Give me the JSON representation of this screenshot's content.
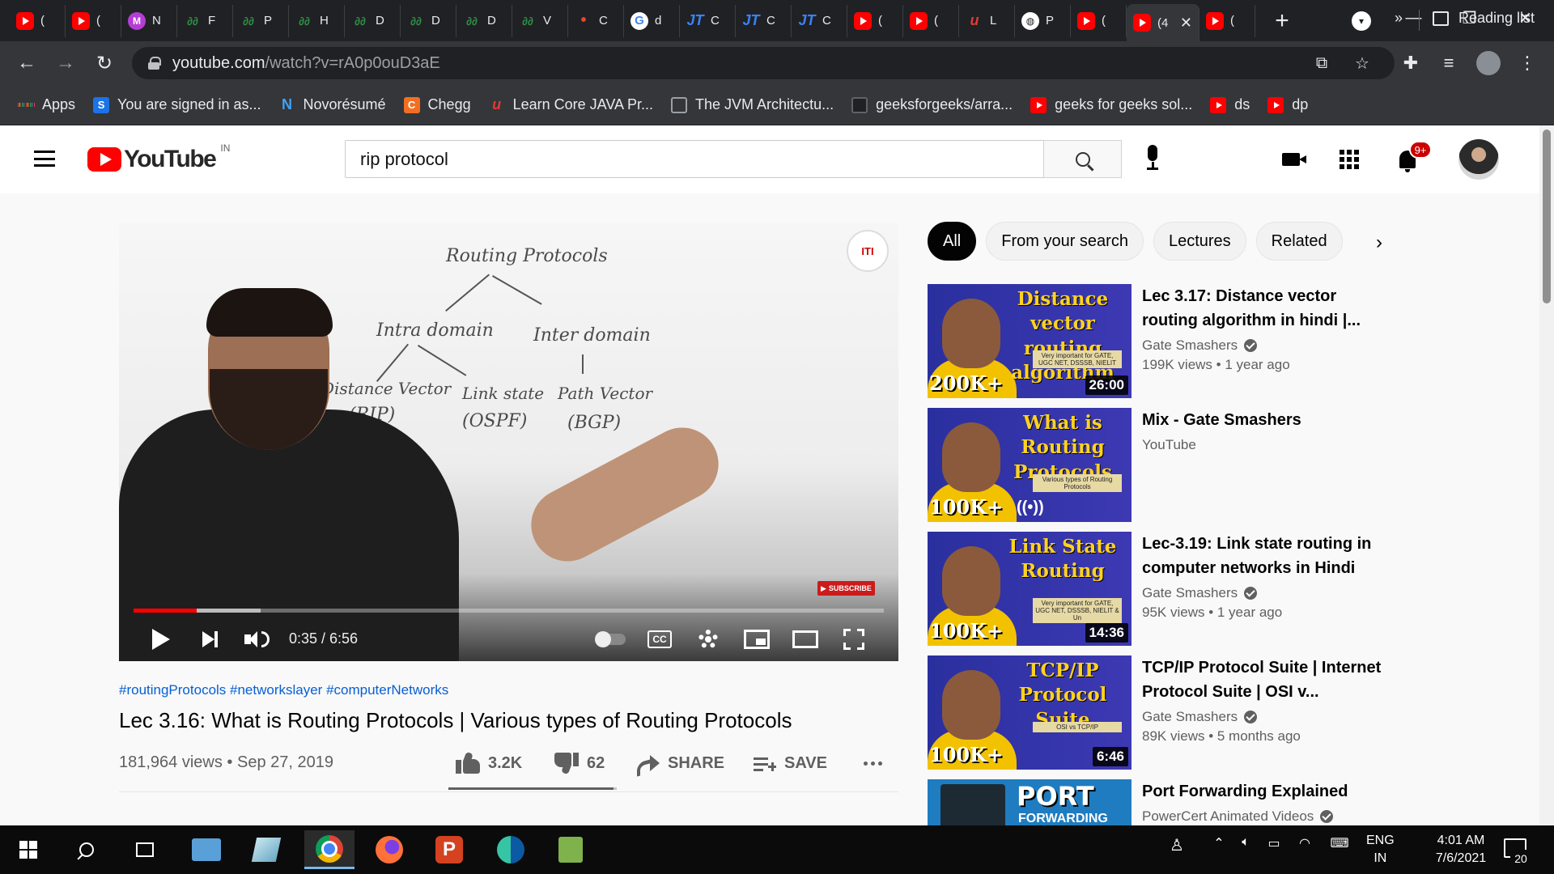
{
  "browser": {
    "tabs": [
      {
        "favicon": "youtube-icon",
        "label": "("
      },
      {
        "favicon": "youtube-icon",
        "label": "("
      },
      {
        "favicon": "messenger-m-icon",
        "label": "N"
      },
      {
        "favicon": "gfg-icon",
        "label": "F"
      },
      {
        "favicon": "gfg-icon",
        "label": "P"
      },
      {
        "favicon": "gfg-icon",
        "label": "H"
      },
      {
        "favicon": "gfg-icon",
        "label": "D"
      },
      {
        "favicon": "gfg-icon",
        "label": "D"
      },
      {
        "favicon": "gfg-icon",
        "label": "D"
      },
      {
        "favicon": "gfg-icon",
        "label": "V"
      },
      {
        "favicon": "red-dot-icon",
        "label": "C"
      },
      {
        "favicon": "google-icon",
        "label": "d"
      },
      {
        "favicon": "javatpoint-icon",
        "label": "C"
      },
      {
        "favicon": "javatpoint-icon",
        "label": "C"
      },
      {
        "favicon": "javatpoint-icon",
        "label": "C"
      },
      {
        "favicon": "youtube-icon",
        "label": "("
      },
      {
        "favicon": "youtube-icon",
        "label": "("
      },
      {
        "favicon": "udemy-icon",
        "label": "L"
      },
      {
        "favicon": "globe-icon",
        "label": "P"
      },
      {
        "favicon": "youtube-icon",
        "label": "("
      },
      {
        "favicon": "youtube-icon",
        "label": "(4",
        "active": true
      },
      {
        "favicon": "youtube-icon",
        "label": "("
      }
    ],
    "new_tab": "+",
    "url_host": "youtube.com",
    "url_path": "/watch?v=rA0p0ouD3aE",
    "bookmarks": [
      {
        "icon": "apps-grid-icon",
        "label": "Apps"
      },
      {
        "icon": "s-icon",
        "label": "You are signed in as..."
      },
      {
        "icon": "novoresume-icon",
        "label": "Novorésumé"
      },
      {
        "icon": "chegg-icon",
        "label": "Chegg"
      },
      {
        "icon": "udemy-icon",
        "label": "Learn Core JAVA Pr..."
      },
      {
        "icon": "jvm-icon",
        "label": "The JVM Architectu..."
      },
      {
        "icon": "github-icon",
        "label": "geeksforgeeks/arra..."
      },
      {
        "icon": "youtube-icon",
        "label": "geeks for geeks sol..."
      },
      {
        "icon": "youtube-icon",
        "label": "ds"
      },
      {
        "icon": "youtube-icon",
        "label": "dp"
      }
    ],
    "bookmarks_more": "»",
    "reading_list": "Reading list"
  },
  "youtube": {
    "logo_text": "YouTube",
    "country_code": "IN",
    "search_query": "rip protocol",
    "notification_count": "9+",
    "accent_color": "#ff0000"
  },
  "player": {
    "time_display": "0:35 / 6:56",
    "progress_played_fraction": 0.084,
    "progress_buffered_fraction": 0.169,
    "subscribe_watermark": "SUBSCRIBE",
    "cc_label": "CC",
    "whiteboard": {
      "root": "Routing Protocols",
      "left": "Intra domain",
      "right": "Inter domain",
      "leaf1": "Distance Vector",
      "leaf1_sub": "(RIP)",
      "leaf2": "Link state",
      "leaf2_sub": "(OSPF)",
      "leaf3": "Path Vector",
      "leaf3_sub": "(BGP)"
    }
  },
  "video": {
    "hashtags": "#routingProtocols #networkslayer #computerNetworks",
    "title": "Lec 3.16: What is Routing Protocols | Various types of Routing Protocols",
    "views_date": "181,964 views • Sep 27, 2019",
    "likes": "3.2K",
    "dislikes": "62",
    "like_ratio": 0.98,
    "share_label": "SHARE",
    "save_label": "SAVE"
  },
  "sidebar": {
    "chips": [
      "All",
      "From your search",
      "Lectures",
      "Related"
    ],
    "related": [
      {
        "thumb_text": "Distance vector routing algorithm",
        "thumb_note": "Very important for GATE, UGC NET, DSSSB, NIELIT",
        "thumb_badge": "200K+",
        "duration": "26:00",
        "title": "Lec 3.17: Distance vector routing algorithm in hindi |...",
        "channel": "Gate Smashers",
        "verified": true,
        "meta": "199K views • 1 year ago"
      },
      {
        "thumb_text": "What is Routing Protocols",
        "thumb_note": "Various types of Routing Protocols",
        "thumb_badge": "100K+",
        "duration": "",
        "title": "Mix - Gate Smashers",
        "channel": "YouTube",
        "verified": false,
        "meta": ""
      },
      {
        "thumb_text": "Link State Routing",
        "thumb_note": "Very important for GATE, UGC NET, DSSSB, NIELIT & Un",
        "thumb_badge": "100K+",
        "duration": "14:36",
        "title": "Lec-3.19: Link state routing in computer networks in Hindi",
        "channel": "Gate Smashers",
        "verified": true,
        "meta": "95K views • 1 year ago"
      },
      {
        "thumb_text": "TCP/IP Protocol Suite",
        "thumb_note": "OSI vs TCP/IP",
        "thumb_badge": "100K+",
        "duration": "6:46",
        "title": "TCP/IP Protocol Suite | Internet Protocol Suite | OSI v...",
        "channel": "Gate Smashers",
        "verified": true,
        "meta": "89K views • 5 months ago"
      },
      {
        "thumb_text": "PORT",
        "thumb_note": "FORWARDING",
        "thumb_badge": "",
        "duration": "",
        "title": "Port Forwarding Explained",
        "channel": "PowerCert Animated Videos",
        "verified": true,
        "meta": ""
      }
    ]
  },
  "taskbar": {
    "language": "ENG",
    "region": "IN",
    "time": "4:01 AM",
    "date": "7/6/2021",
    "notification_count": "20"
  }
}
